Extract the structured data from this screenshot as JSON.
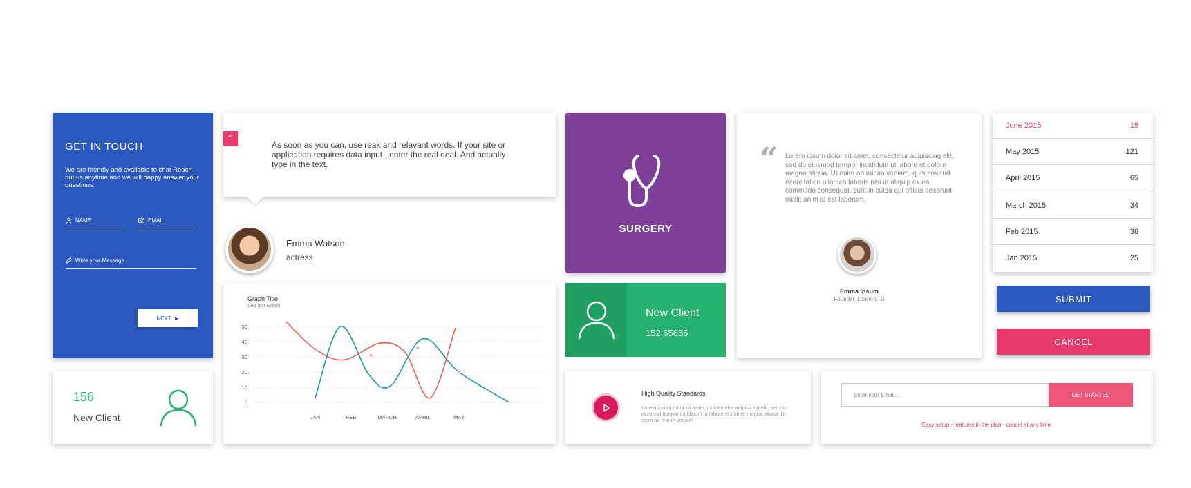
{
  "contact": {
    "title": "GET IN TOUCH",
    "description": "We are friendly and available to chat Reach out us anytime and we will happy answer your questions.",
    "name_placeholder": "NAME",
    "email_placeholder": "EMAIL",
    "message_placeholder": "Write your Message..",
    "next_label": "NEXT"
  },
  "client_small": {
    "count": "156",
    "label": "New Client"
  },
  "quote": {
    "badge": "“",
    "text": "As soon as you can, use reak and relavant words. If your site or application requires data input , enter the real deal. And actually type in the text."
  },
  "person": {
    "name": "Emma Watson",
    "role": "actress"
  },
  "surgery": {
    "label": "SURGERY"
  },
  "client_green": {
    "title": "New Client",
    "value": "152,65656"
  },
  "testimonial": {
    "quote_mark": "“",
    "text": "Lorem ipsum dolor sit amet, consectetur adipiscing elit, sed do eiusmod tempor incididunt ut labore et dolore magna aliqua. Ut enim ad minim veniam, quis nostrud exercitation ullamco laboris nisi ut aliquip ex ea commodo consequat. sunt in culpa qui officia deserunt mollit anim id est laborum.",
    "name": "Emma Ipsum",
    "role": "Founder, Lorem LTD"
  },
  "months": [
    {
      "label": "June 2015",
      "value": "15"
    },
    {
      "label": "May 2015",
      "value": "121"
    },
    {
      "label": "April 2015",
      "value": "65"
    },
    {
      "label": "March 2015",
      "value": "34"
    },
    {
      "label": "Feb 2015",
      "value": "36"
    },
    {
      "label": "Jan 2015",
      "value": "25"
    }
  ],
  "buttons": {
    "submit": "SUBMIT",
    "cancel": "CANCEL"
  },
  "feature": {
    "title": "High Quality Standards",
    "text": "Lorem ipsum dolor sit amet, consectetur adipisicing elit, sed do eiusmod tempor incididunt ut labore et dolore magna aliqua. Ut enim ad minim veniam"
  },
  "subscribe": {
    "placeholder": "Enter your Email...",
    "button": "GET STARTED",
    "note": "Easy setup - features in the plan - cancel at any time."
  },
  "colors": {
    "blue": "#2b59be",
    "pink": "#e83a6d",
    "purple": "#7e3f98",
    "green": "#25b36f",
    "teal": "#1a9aa0",
    "red_line": "#f05a5a"
  },
  "chart_data": {
    "type": "line",
    "title": "Graph Title",
    "subtitle": "Sub text Graph",
    "categories": [
      "JAN",
      "FEB",
      "MARCH",
      "APRIL",
      "MAY"
    ],
    "ylim": [
      0,
      50
    ],
    "yticks": [
      0,
      10,
      20,
      30,
      40,
      50
    ],
    "grid": true,
    "series": [
      {
        "color": "#f05a5a",
        "points": [
          [
            -0.8,
            53
          ],
          [
            0,
            35
          ],
          [
            0.8,
            28
          ],
          [
            1.8,
            39
          ],
          [
            2.5,
            33
          ],
          [
            3.2,
            3
          ],
          [
            3.9,
            49
          ]
        ]
      },
      {
        "color": "#1a9aa0",
        "points": [
          [
            0,
            3
          ],
          [
            0.7,
            50
          ],
          [
            1.5,
            18
          ],
          [
            2.1,
            11
          ],
          [
            3.0,
            42
          ],
          [
            4.0,
            20
          ],
          [
            5.4,
            0
          ]
        ]
      }
    ]
  }
}
